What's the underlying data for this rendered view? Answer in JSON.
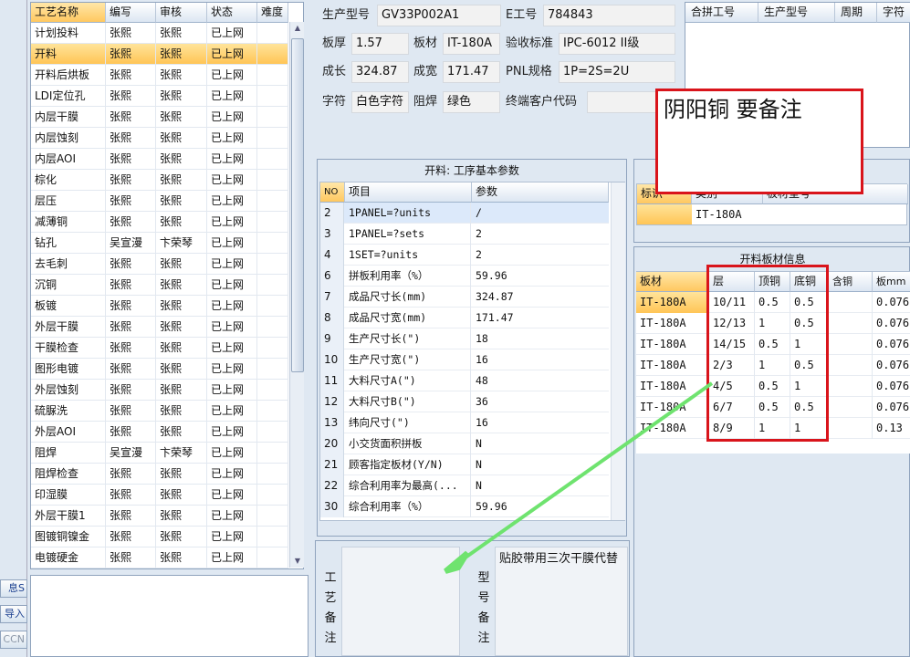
{
  "left_buttons": [
    "息S",
    "导入",
    "CCN"
  ],
  "process_list": {
    "headers": [
      "工艺名称",
      "编写",
      "审核",
      "状态",
      "难度"
    ],
    "rows": [
      [
        "计划投料",
        "张熙",
        "张熙",
        "已上网"
      ],
      [
        "开料",
        "张熙",
        "张熙",
        "已上网"
      ],
      [
        "开料后烘板",
        "张熙",
        "张熙",
        "已上网"
      ],
      [
        "LDI定位孔",
        "张熙",
        "张熙",
        "已上网"
      ],
      [
        "内层干膜",
        "张熙",
        "张熙",
        "已上网"
      ],
      [
        "内层蚀刻",
        "张熙",
        "张熙",
        "已上网"
      ],
      [
        "内层AOI",
        "张熙",
        "张熙",
        "已上网"
      ],
      [
        "棕化",
        "张熙",
        "张熙",
        "已上网"
      ],
      [
        "层压",
        "张熙",
        "张熙",
        "已上网"
      ],
      [
        "减薄铜",
        "张熙",
        "张熙",
        "已上网"
      ],
      [
        "钻孔",
        "吴宣漫",
        "卞荣琴",
        "已上网"
      ],
      [
        "去毛刺",
        "张熙",
        "张熙",
        "已上网"
      ],
      [
        "沉铜",
        "张熙",
        "张熙",
        "已上网"
      ],
      [
        "板镀",
        "张熙",
        "张熙",
        "已上网"
      ],
      [
        "外层干膜",
        "张熙",
        "张熙",
        "已上网"
      ],
      [
        "干膜检查",
        "张熙",
        "张熙",
        "已上网"
      ],
      [
        "图形电镀",
        "张熙",
        "张熙",
        "已上网"
      ],
      [
        "外层蚀刻",
        "张熙",
        "张熙",
        "已上网"
      ],
      [
        "硫脲洗",
        "张熙",
        "张熙",
        "已上网"
      ],
      [
        "外层AOI",
        "张熙",
        "张熙",
        "已上网"
      ],
      [
        "阻焊",
        "吴宣漫",
        "卞荣琴",
        "已上网"
      ],
      [
        "阻焊检查",
        "张熙",
        "张熙",
        "已上网"
      ],
      [
        "印湿膜",
        "张熙",
        "张熙",
        "已上网"
      ],
      [
        "外层干膜1",
        "张熙",
        "张熙",
        "已上网"
      ],
      [
        "图镀铜镍金",
        "张熙",
        "张熙",
        "已上网"
      ],
      [
        "电镀硬金",
        "张熙",
        "张熙",
        "已上网"
      ]
    ]
  },
  "header": {
    "prod_model_label": "生产型号",
    "prod_model": "GV33P002A1",
    "e_no_label": "E工号",
    "e_no": "784843",
    "thickness_label": "板厚",
    "thickness": "1.57",
    "material_label": "板材",
    "material": "IT-180A",
    "acceptance_label": "验收标准",
    "acceptance": "IPC-6012 II级",
    "length_label": "成长",
    "length": "324.87",
    "width_label": "成宽",
    "width": "171.47",
    "pnl_label": "PNL规格",
    "pnl": "1P=2S=2U",
    "char_label": "字符",
    "char": "白色字符",
    "mask_label": "阻焊",
    "mask": "绿色",
    "customer_label": "终端客户代码",
    "customer": ""
  },
  "combined": {
    "headers": [
      "合拼工号",
      "生产型号",
      "周期",
      "字符"
    ]
  },
  "params": {
    "title": "开料: 工序基本参数",
    "headers": [
      "NO",
      "项目",
      "参数"
    ],
    "rows": [
      [
        "2",
        "1PANEL=?units",
        "/"
      ],
      [
        "3",
        "1PANEL=?sets",
        "2"
      ],
      [
        "4",
        "1SET=?units",
        "2"
      ],
      [
        "6",
        "拼板利用率（%）",
        "59.96"
      ],
      [
        "7",
        "成品尺寸长(mm)",
        "324.87"
      ],
      [
        "8",
        "成品尺寸宽(mm)",
        "171.47"
      ],
      [
        "9",
        "生产尺寸长(\")",
        "18"
      ],
      [
        "10",
        "生产尺寸宽(\")",
        "16"
      ],
      [
        "11",
        "大料尺寸A(\")",
        "48"
      ],
      [
        "12",
        "大料尺寸B(\")",
        "36"
      ],
      [
        "13",
        "纬向尺寸(\")",
        "16"
      ],
      [
        "20",
        "小交货面积拼板",
        "N"
      ],
      [
        "21",
        "顾客指定板材(Y/N)",
        "N"
      ],
      [
        "22",
        "综合利用率为最高(...",
        "N"
      ],
      [
        "30",
        "综合利用率（%）",
        "59.96"
      ]
    ]
  },
  "remarks": {
    "process_label": "工艺备注",
    "model_label": "型号备注",
    "model_text": "贴胶带用三次干膜代替"
  },
  "mat_top": {
    "headers": [
      "标识",
      "类别",
      "板材型号"
    ],
    "row": [
      "",
      "IT-180A",
      ""
    ]
  },
  "materials": {
    "title": "开料板材信息",
    "headers": [
      "板材",
      "层",
      "顶铜",
      "底铜",
      "含铜mm",
      "板mm"
    ],
    "rows": [
      [
        "IT-180A",
        "10/11",
        "0.5",
        "0.5",
        "",
        "0.076"
      ],
      [
        "IT-180A",
        "12/13",
        "1",
        "0.5",
        "",
        "0.076"
      ],
      [
        "IT-180A",
        "14/15",
        "0.5",
        "1",
        "",
        "0.076"
      ],
      [
        "IT-180A",
        "2/3",
        "1",
        "0.5",
        "",
        "0.076"
      ],
      [
        "IT-180A",
        "4/5",
        "0.5",
        "1",
        "",
        "0.076"
      ],
      [
        "IT-180A",
        "6/7",
        "0.5",
        "0.5",
        "",
        "0.076"
      ],
      [
        "IT-180A",
        "8/9",
        "1",
        "1",
        "",
        "0.13"
      ]
    ]
  },
  "annotation": {
    "callout_text": "阴阳铜  要备注"
  },
  "colors": {
    "highlight": "#ffc556",
    "annotation_red": "#d9141b",
    "arrow_green": "#6fe36f"
  }
}
